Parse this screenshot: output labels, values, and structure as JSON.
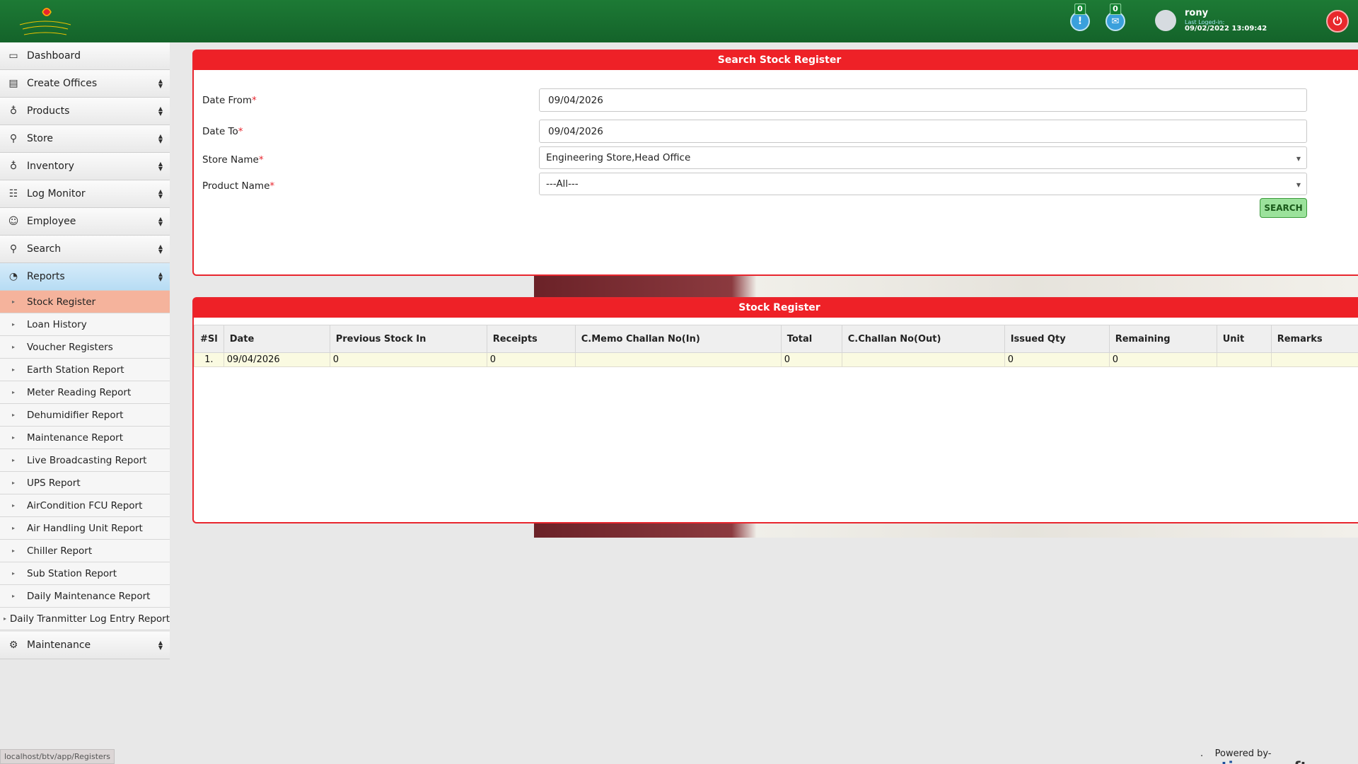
{
  "header": {
    "notifications": [
      {
        "icon": "alert-icon",
        "count": "0"
      },
      {
        "icon": "mail-icon",
        "count": "0"
      }
    ],
    "user": {
      "name": "rony",
      "last_logged_label": "Last Loged-in:",
      "last_logged_time": "09/02/2022 13:09:42"
    }
  },
  "sidebar": {
    "menus": [
      {
        "label": "Dashboard",
        "icon": "monitor-icon"
      },
      {
        "label": "Create Offices",
        "icon": "building-icon"
      },
      {
        "label": "Products",
        "icon": "bulb-icon"
      },
      {
        "label": "Store",
        "icon": "search-icon"
      },
      {
        "label": "Inventory",
        "icon": "bulb-icon"
      },
      {
        "label": "Log Monitor",
        "icon": "sliders-icon"
      },
      {
        "label": "Employee",
        "icon": "users-icon"
      },
      {
        "label": "Search",
        "icon": "search-icon"
      },
      {
        "label": "Reports",
        "icon": "pie-chart-icon"
      }
    ],
    "report_items": [
      "Stock Register",
      "Loan History",
      "Voucher Registers",
      "Earth Station Report",
      "Meter Reading Report",
      "Dehumidifier Report",
      "Maintenance Report",
      "Live Broadcasting Report",
      "UPS Report",
      "AirCondition FCU Report",
      "Air Handling Unit Report",
      "Chiller Report",
      "Sub Station Report",
      "Daily Maintenance Report",
      "Daily Tranmitter Log Entry Report"
    ],
    "footer_menu": {
      "label": "Maintenance",
      "icon": "gear-icon"
    }
  },
  "search_panel": {
    "title": "Search Stock Register",
    "date_from_label": "Date From",
    "date_from_value": "09/04/2026",
    "date_to_label": "Date To",
    "date_to_value": "09/04/2026",
    "store_name_label": "Store Name",
    "store_name_value": "Engineering Store,Head Office",
    "product_name_label": "Product Name",
    "product_name_value": "---All---",
    "search_button": "SEARCH"
  },
  "register_panel": {
    "title": "Stock Register",
    "columns": [
      "#Sl",
      "Date",
      "Previous Stock In",
      "Receipts",
      "C.Memo Challan No(In)",
      "Total",
      "C.Challan No(Out)",
      "Issued Qty",
      "Remaining",
      "Unit",
      "Remarks"
    ],
    "rows": [
      [
        "1.",
        "09/04/2026",
        "0",
        "0",
        "",
        "0",
        "",
        "0",
        "0",
        "",
        ""
      ]
    ]
  },
  "status_bar": {
    "url": "localhost/btv/app/Registers"
  },
  "footer": {
    "dot": ".",
    "powered_by": "Powered by-",
    "brand_main": "optimum",
    "brand_suffix": "soft"
  },
  "colors": {
    "header_green": "#14632a",
    "panel_red": "#ee2127",
    "active_sub": "#f5b39c",
    "active_menu": "#b7dcf4"
  }
}
